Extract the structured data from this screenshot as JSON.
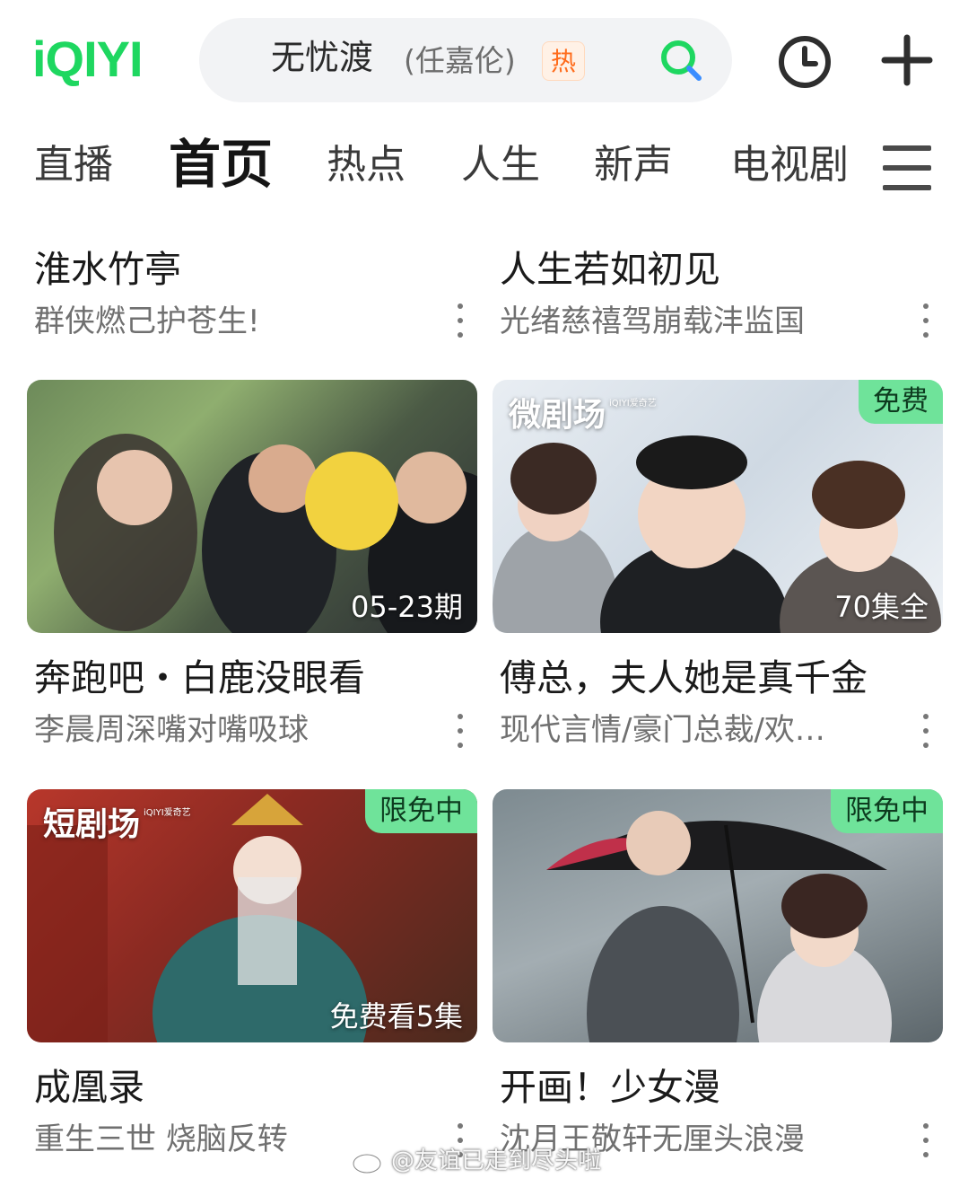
{
  "header": {
    "logo": "iQIYI",
    "search": {
      "query": "无忧渡",
      "sub": "(任嘉伦)",
      "hot_tag": "热"
    },
    "icons": {
      "search": "search-icon",
      "history": "clock-icon",
      "add": "plus-icon"
    }
  },
  "tabs": [
    {
      "label": "直播"
    },
    {
      "label": "首页",
      "active": true
    },
    {
      "label": "热点"
    },
    {
      "label": "人生"
    },
    {
      "label": "新声"
    },
    {
      "label": "电视剧"
    }
  ],
  "top_items": [
    {
      "title": "淮水竹亭",
      "subtitle": "群侠燃己护苍生!"
    },
    {
      "title": "人生若如初见",
      "subtitle": "光绪慈禧驾崩载沣监国"
    }
  ],
  "cards": [
    {
      "title": "奔跑吧・白鹿没眼看",
      "subtitle": "李晨周深嘴对嘴吸球",
      "overlay": "05-23期"
    },
    {
      "title": "傅总，夫人她是真千金",
      "subtitle": "现代言情/豪门总裁/欢…",
      "overlay": "70集全",
      "badge": "免费",
      "brand": "微剧场"
    },
    {
      "title": "成凰录",
      "subtitle": "重生三世 烧脑反转",
      "overlay": "免费看5集",
      "badge": "限免中",
      "brand": "短剧场"
    },
    {
      "title": "开画！少女漫",
      "subtitle": "沈月王敬轩无厘头浪漫",
      "badge": "限免中"
    }
  ],
  "brand_small": "iQIYI爱奇艺",
  "watermark": "@友谊已走到尽头啦",
  "colors": {
    "brand_green": "#1ed760",
    "badge_green": "#6fe39a",
    "hot_orange": "#ff6b1a"
  }
}
